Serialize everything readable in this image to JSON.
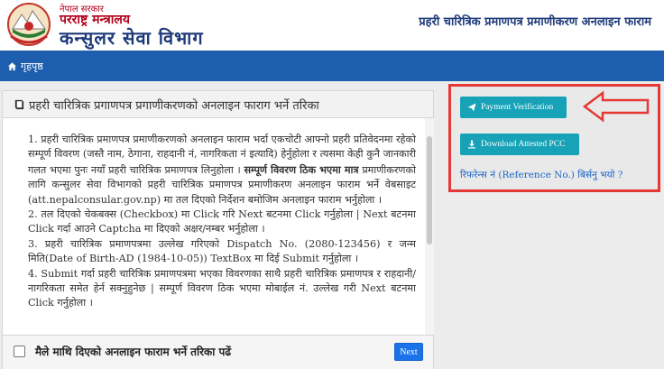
{
  "header": {
    "gov_small": "नेपाल सरकार",
    "ministry": "परराष्ट्र मन्त्रालय",
    "department": "कन्सुलर सेवा विभाग",
    "page_title": "प्रहरी चारित्रिक प्रमाणपत्र प्रमाणीकरण अनलाइन फाराम"
  },
  "nav": {
    "home_label": "गृहपृष्ठ"
  },
  "panel": {
    "title": "प्रहरी चारित्रिक प्रगाणपत्र प्रगाणीकरणको अनलाइन फाराग भर्ने तरिका",
    "items": [
      {
        "pre": "1. प्रहरी चारित्रिक प्रमाणपत्र प्रमाणीकरणको अनलाइन फाराम भर्दा एकचोटी आफ्नो प्रहरी प्रतिवेदनमा रहेको सम्पूर्ण विवरण (जस्तै नाम, ठेगाना, राहदानी नं, नागरिकता नं इत्यादि) हेर्नुहोला र त्यसमा केही कुनै जानकारी गलत भएमा पुनः नयाँ प्रहरी चारित्रिक प्रमाणपत्र लिनुहोला ।",
        "bold": "सम्पूर्ण विवरण ठिक भएमा मात्र",
        "post": "प्रमाणीकरणको लागि कन्सुलर सेवा विभागको प्रहरी चारित्रिक प्रमाणपत्र प्रमाणीकरण अनलाइन फाराम भर्ने वेबसाइट (att.nepalconsular.gov.np) मा तल दिएको निर्देशन बमोजिम अनलाइन फाराम भर्नुहोला ।"
      },
      {
        "text": "2. तल दिएको चेकबक्स (Checkbox) मा Click गरि Next बटनमा Click गर्नुहोला | Next बटनमा Click गर्दा आउने Captcha मा दिएको अक्षर/नम्बर भर्नुहोला ।"
      },
      {
        "text": "3. प्रहरी चारित्रिक प्रमाणपत्रमा उल्लेख गरिएको Dispatch No. (2080-123456) र जन्म मिति(Date of Birth-AD (1984-10-05)) TextBox मा दिई Submit गर्नुहोला ।"
      },
      {
        "text": "4. Submit गर्दा प्रहरी चारित्रिक प्रमाणपत्रमा भएका विवरणका साथै प्रहरी चारित्रिक प्रमाणपत्र र राहदानी/नागरिकता समेत हेर्न सक्नुहुनेछ | सम्पूर्ण विवरण ठिक भएमा मोबाईल नं. उल्लेख गरी Next बटनमा Click गर्नुहोला ।"
      }
    ],
    "checkbox_label": "मैले माथि दिएको अनलाइन फाराम भर्ने तरिका पढें",
    "next_label": "Next"
  },
  "side": {
    "payment_label": "Payment Verification",
    "download_label": "Download Attested PCC",
    "reference_link": "रिफरेन्स नं (Reference No.) बिर्सनु भयो ?"
  },
  "colors": {
    "nav_blue": "#1d5fae",
    "teal_button": "#17a2b8",
    "highlight_red": "#e53935",
    "dept_blue": "#1e3a7a"
  }
}
